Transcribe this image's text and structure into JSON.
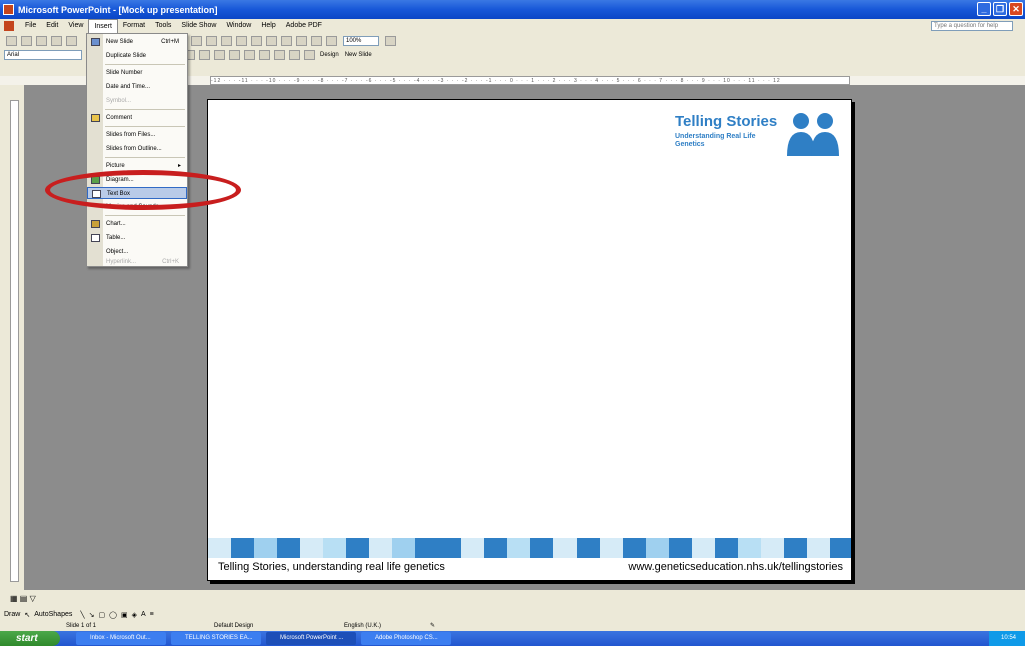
{
  "window": {
    "title": "Microsoft PowerPoint - [Mock up presentation]"
  },
  "menubar": {
    "items": [
      "File",
      "Edit",
      "View",
      "Insert",
      "Format",
      "Tools",
      "Slide Show",
      "Window",
      "Help",
      "Adobe PDF"
    ],
    "active": "Insert",
    "help_placeholder": "Type a question for help"
  },
  "toolbar": {
    "zoom": "100%",
    "font": "Arial",
    "design_label": "Design",
    "new_slide_label": "New Slide"
  },
  "ruler": {
    "h_labels": "-12 · · · -11 · · · -10 · · · -9 · · · -8 · · · -7 · · · -6 · · · -5 · · · -4 · · · -3 · · · -2 · · · -1 · · · 0 · · · 1 · · · 2 · · · 3 · · · 4 · · · 5 · · · 6 · · · 7 · · · 8 · · · 9 · · · 10 · · · 11 · · · 12"
  },
  "insert_menu": {
    "items": [
      {
        "label": "New Slide",
        "shortcut": "Ctrl+M",
        "disabled": false
      },
      {
        "label": "Duplicate Slide",
        "shortcut": "",
        "disabled": false
      },
      {
        "label": "Slide Number",
        "shortcut": "",
        "disabled": false
      },
      {
        "label": "Date and Time...",
        "shortcut": "",
        "disabled": false
      },
      {
        "label": "Symbol...",
        "shortcut": "",
        "disabled": true
      },
      {
        "label": "Comment",
        "shortcut": "",
        "disabled": false
      },
      {
        "label": "Slides from Files...",
        "shortcut": "",
        "disabled": false
      },
      {
        "label": "Slides from Outline...",
        "shortcut": "",
        "disabled": false
      },
      {
        "label": "Picture",
        "shortcut": "",
        "disabled": false
      },
      {
        "label": "Diagram...",
        "shortcut": "",
        "disabled": false
      },
      {
        "label": "Text Box",
        "shortcut": "",
        "disabled": false
      },
      {
        "label": "Movies and Sounds",
        "shortcut": "",
        "disabled": false
      },
      {
        "label": "Chart...",
        "shortcut": "",
        "disabled": false
      },
      {
        "label": "Table...",
        "shortcut": "",
        "disabled": false
      },
      {
        "label": "Object...",
        "shortcut": "",
        "disabled": false
      },
      {
        "label": "Hyperlink...",
        "shortcut": "Ctrl+K",
        "disabled": true
      }
    ],
    "highlighted": "Text Box"
  },
  "slide": {
    "brand_title": "Telling Stories",
    "brand_subtitle": "Understanding Real Life Genetics",
    "footer_left": "Telling Stories, understanding real life genetics",
    "footer_right": "www.geneticseducation.nhs.uk/tellingstories",
    "accent_color": "#2f7fc5"
  },
  "drawbar": {
    "draw_label": "Draw",
    "autoshapes_label": "AutoShapes"
  },
  "status": {
    "slide": "Slide 1 of 1",
    "design": "Default Design",
    "language": "English (U.K.)"
  },
  "taskbar": {
    "start": "start",
    "tasks": [
      "Inbox - Microsoft Out...",
      "TELLING STORIES EA...",
      "Microsoft PowerPoint ...",
      "Adobe Photoshop CS..."
    ],
    "clock": "10:54"
  }
}
